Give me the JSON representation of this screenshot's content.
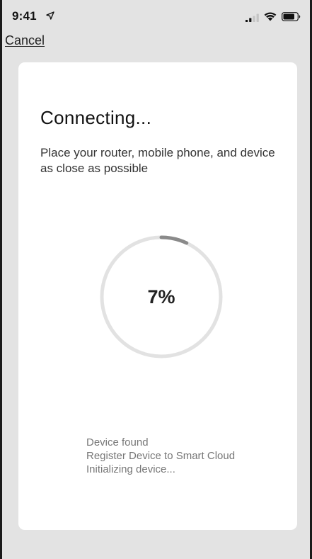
{
  "status_bar": {
    "time": "9:41"
  },
  "navigation": {
    "cancel_label": "Cancel"
  },
  "card": {
    "title": "Connecting...",
    "subtitle": "Place your router, mobile phone, and device as close as possible",
    "progress": {
      "percent": 7,
      "label": "7%"
    },
    "status_steps": [
      "Device found",
      "Register Device to Smart Cloud",
      "Initializing device..."
    ]
  },
  "icons": {
    "location": "location-arrow-icon",
    "signal": "signal-strength-icon",
    "wifi": "wifi-icon",
    "battery": "battery-icon"
  },
  "colors": {
    "background": "#e3e3e3",
    "card": "#ffffff",
    "progress_track": "#e2e2e2",
    "progress_fill": "#8a8a8a",
    "status_text": "#777777"
  }
}
